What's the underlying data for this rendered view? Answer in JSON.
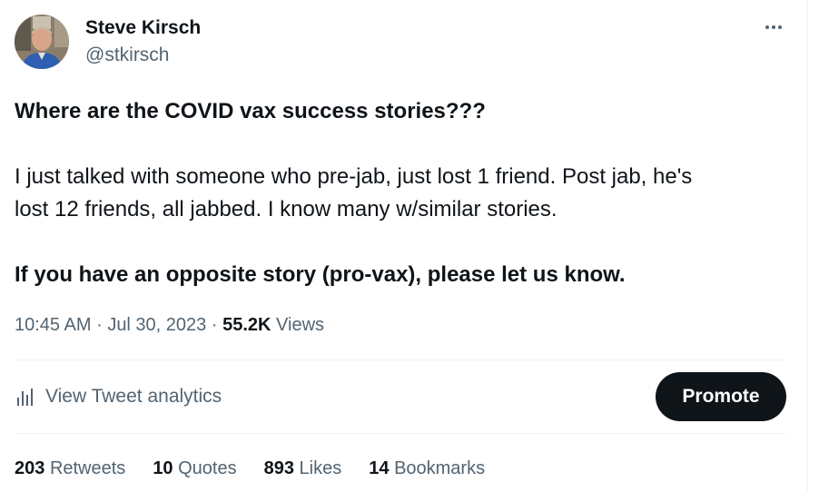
{
  "author": {
    "name": "Steve Kirsch",
    "handle": "@stkirsch"
  },
  "tweet": {
    "headline": "Where are the COVID vax success stories???",
    "body_line_1": "I just talked with someone who pre-jab, just lost 1 friend. Post jab, he's",
    "body_line_2": "lost 12 friends, all jabbed. I know many w/similar stories.",
    "closing": "If you have an opposite story (pro-vax), please let us know."
  },
  "meta": {
    "time": "10:45 AM",
    "separator": "·",
    "date": "Jul 30, 2023",
    "views_count": "55.2K",
    "views_label": "Views"
  },
  "analytics": {
    "label": "View Tweet analytics",
    "icon": "bar-chart-icon"
  },
  "promote": {
    "label": "Promote"
  },
  "stats": [
    {
      "count": "203",
      "label": "Retweets"
    },
    {
      "count": "10",
      "label": "Quotes"
    },
    {
      "count": "893",
      "label": "Likes"
    },
    {
      "count": "14",
      "label": "Bookmarks"
    }
  ],
  "colors": {
    "text_primary": "#0f1419",
    "text_secondary": "#536471",
    "divider": "#eff3f4",
    "promote_bg": "#0f1419"
  }
}
